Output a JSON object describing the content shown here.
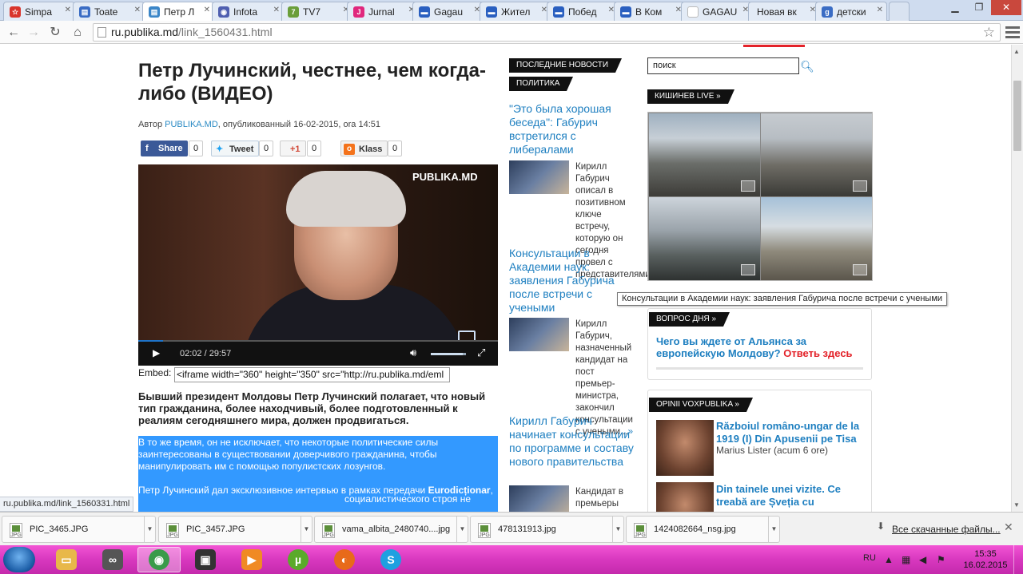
{
  "browser": {
    "tabs": [
      {
        "label": "Simpa",
        "fav_color": "#d9342b",
        "fav_char": "☆"
      },
      {
        "label": "Toate",
        "fav_color": "#3a6cc4",
        "fav_char": "▤"
      },
      {
        "label": "Петр Л",
        "fav_color": "#3b86c8",
        "fav_char": "▤",
        "active": true
      },
      {
        "label": "Infota",
        "fav_color": "#4f5fb0",
        "fav_char": "◉"
      },
      {
        "label": "TV7",
        "fav_color": "#6a9e3a",
        "fav_char": "7"
      },
      {
        "label": "Jurnal",
        "fav_color": "#e0277d",
        "fav_char": "J"
      },
      {
        "label": "Gagau",
        "fav_color": "#2a5fc0",
        "fav_char": "▬"
      },
      {
        "label": "Жител",
        "fav_color": "#2a5fc0",
        "fav_char": "▬"
      },
      {
        "label": "Побед",
        "fav_color": "#2a5fc0",
        "fav_char": "▬"
      },
      {
        "label": "В Ком",
        "fav_color": "#2a5fc0",
        "fav_char": "▬"
      },
      {
        "label": "GAGAU",
        "fav_color": "#cccccc",
        "fav_char": ""
      },
      {
        "label": "Новая вк",
        "fav_color": "",
        "fav_char": ""
      },
      {
        "label": "детски",
        "fav_color": "#3a6cc4",
        "fav_char": "g"
      }
    ],
    "url_host": "ru.publika.md",
    "url_path": "/link_1560431.html"
  },
  "article": {
    "title": "Петр Лучинский, честнее, чем когда-либо (ВИДЕО)",
    "byline_prefix": "Автор",
    "author": "PUBLIKA.MD",
    "byline_suffix": ", опубликованный 16-02-2015, ora 14:51",
    "share": {
      "facebook": "Share",
      "facebook_count": "0",
      "tweet": "Tweet",
      "tweet_count": "0",
      "gplus": "+1",
      "gplus_count": "0",
      "klass": "Klass",
      "klass_count": "0"
    },
    "video": {
      "logo": "PUBLIKA.MD",
      "time": "02:02  /  29:57",
      "progress": 0.069
    },
    "embed_label": "Embed:",
    "embed_code": "<iframe width=\"360\" height=\"350\" src=\"http://ru.publika.md/eml",
    "lead": "Бывший президент Молдовы Петр Лучинский полагает, что новый тип гражданина, более находчивый, более подготовленный к реалиям сегодняшнего мира, должен продвигаться.",
    "para1": "В то же время, он не исключает, что некоторые политические силы заинтересованы в существовании доверчивого гражданина, чтобы манипулировать им с помощью популистских лозунгов.",
    "para2_a": "Петр Лучинский дал эксклюзивное интервью в рамках передачи ",
    "para2_b": "Eurodicționar",
    "para2_c": ",",
    "para2_tail": "социалистического строя не"
  },
  "middle": {
    "tag_latest": "ПОСЛЕДНИЕ НОВОСТИ",
    "tag_politics": "ПОЛИТИКА",
    "news": [
      {
        "title": "\"Это была хорошая беседа\": Габурич встретился с либералами",
        "text": "Кирилл Габурич описал в позитивном ключе встречу, которую он сегодня провел с представителями...",
        "more": "»"
      },
      {
        "title": "Консультации в Академии наук: заявления Габурича после встречи с учеными",
        "text": "Кирилл Габурич, назначенный кандидат на пост премьер-министра, закончил консультации с учеными...",
        "more": "»"
      },
      {
        "title": "Кирилл Габурич начинает консультации по программе и составу нового правительства",
        "text": "Кандидат в премьеры",
        "more": ""
      }
    ]
  },
  "right": {
    "search_placeholder": "поиск",
    "tag_live": "КИШИНЕВ LIVE »",
    "tooltip": "Консультации в Академии наук: заявления Габурича после встречи с учеными",
    "tag_question": "ВОПРОС ДНЯ »",
    "question": "Чего вы ждете от Альянса за европейскую Молдову?",
    "question_link": "Ответь здесь",
    "tag_opinii": "OPINII VOXPUBLIKA »",
    "opinions": [
      {
        "title": "Războiul româno-ungar de la 1919 (I) Din Apusenii pe Tisa",
        "meta": "Marius Lister (acum 6 ore)"
      },
      {
        "title": "Din tainele unei vizite. Ce treabă are Șveția cu",
        "meta": ""
      }
    ]
  },
  "status_url": "ru.publika.md/link_1560331.html",
  "downloads": {
    "items": [
      "PIC_3465.JPG",
      "PIC_3457.JPG",
      "vama_albita_2480740....jpg",
      "478131913.jpg",
      "1424082664_nsg.jpg"
    ],
    "show_all": "Все скачанные файлы..."
  },
  "taskbar": {
    "lang": "RU",
    "time": "15:35",
    "date": "16.02.2015",
    "apps": [
      {
        "name": "explorer",
        "color": "#e8b84a",
        "char": "▭"
      },
      {
        "name": "media-goggles",
        "color": "#555555",
        "char": "∞"
      },
      {
        "name": "chrome",
        "color": "#3a9b4a",
        "char": "◉",
        "active": true
      },
      {
        "name": "camera",
        "color": "#333333",
        "char": "▣"
      },
      {
        "name": "player",
        "color": "#f08a24",
        "char": "▶"
      },
      {
        "name": "utorrent",
        "color": "#5aaa2a",
        "char": "µ"
      },
      {
        "name": "firefox",
        "color": "#e86a1a",
        "char": "◐"
      },
      {
        "name": "skype",
        "color": "#1ea0e0",
        "char": "S"
      }
    ]
  }
}
